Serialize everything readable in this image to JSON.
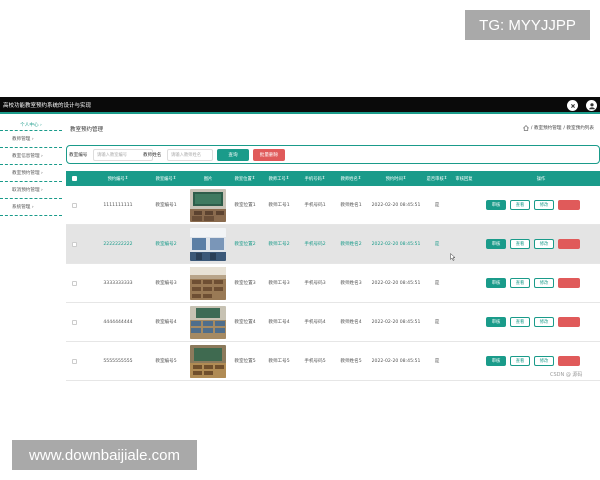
{
  "watermarks": {
    "top": "TG: MYYJJPP",
    "bottom": "www.downbaijiale.com"
  },
  "app": {
    "title": "高校功能教室预约系统的设计与实现"
  },
  "sidebar": {
    "items": [
      {
        "label": "个人中心 ›"
      },
      {
        "label": "教师管理 ›"
      },
      {
        "label": "教室信息管理 ›"
      },
      {
        "label": "教室预约管理 ›"
      },
      {
        "label": "取消预约管理 ›"
      },
      {
        "label": "系统管理 ›"
      }
    ]
  },
  "page": {
    "title": "教室预约管理",
    "breadcrumb": [
      "/ 教室预约管理",
      "/ 教室预约列表"
    ]
  },
  "search": {
    "label1": "教室编号",
    "placeholder1": "请输入教室编号",
    "label2": "教师姓名",
    "placeholder2": "请输入教师姓名",
    "search_label": "查询",
    "add_label": "批量删除"
  },
  "table": {
    "headers": [
      "预约编号",
      "教室编号",
      "图片",
      "教室位置",
      "教师工号",
      "手机号码",
      "教师姓名",
      "预约时间",
      "是否审核",
      "审核回复",
      "操作"
    ],
    "header_suffix": "⇕",
    "rows": [
      {
        "id": "1111111111",
        "room": "教室编号1",
        "location": "教室位置1",
        "teacher_no": "教师工号1",
        "phone": "手机号码1",
        "teacher": "教师姓名1",
        "time": "2022-02-20 08:45:51",
        "audited": "是",
        "reply": ""
      },
      {
        "id": "2222222222",
        "room": "教室编号2",
        "location": "教室位置2",
        "teacher_no": "教师工号2",
        "phone": "手机号码2",
        "teacher": "教师姓名2",
        "time": "2022-02-20 08:45:51",
        "audited": "是",
        "reply": ""
      },
      {
        "id": "3333333333",
        "room": "教室编号3",
        "location": "教室位置3",
        "teacher_no": "教师工号3",
        "phone": "手机号码3",
        "teacher": "教师姓名3",
        "time": "2022-02-20 08:45:51",
        "audited": "是",
        "reply": ""
      },
      {
        "id": "4444444444",
        "room": "教室编号4",
        "location": "教室位置4",
        "teacher_no": "教师工号4",
        "phone": "手机号码4",
        "teacher": "教师姓名4",
        "time": "2022-02-20 08:45:51",
        "audited": "是",
        "reply": ""
      },
      {
        "id": "5555555555",
        "room": "教室编号5",
        "location": "教室位置5",
        "teacher_no": "教师工号5",
        "phone": "手机号码5",
        "teacher": "教师姓名5",
        "time": "2022-02-20 08:45:51",
        "audited": "是",
        "reply": ""
      }
    ],
    "ops": {
      "audit": "审核",
      "view": "查看",
      "edit": "修改",
      "delete": ""
    }
  },
  "footer": {
    "csdn": "CSDN @ 源码"
  },
  "colors": {
    "accent": "#1a9b8a",
    "danger": "#e05a5a",
    "topbar": "#0a0a0a",
    "highlight_row": "#e4e4e4"
  },
  "icons": {
    "close": "close-icon",
    "user": "user-icon",
    "home": "home-icon"
  }
}
